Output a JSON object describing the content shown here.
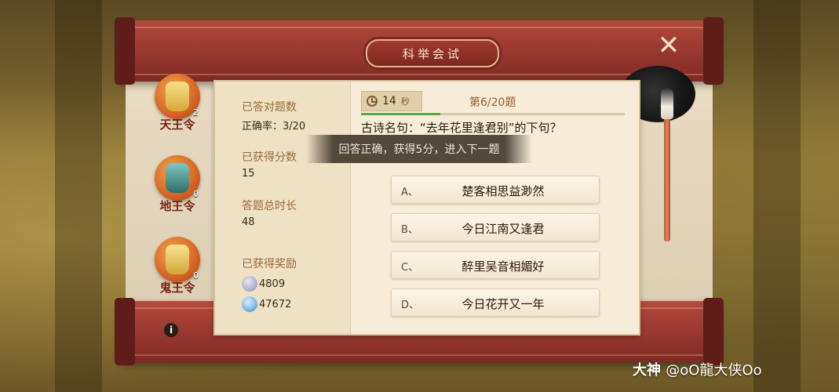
{
  "window": {
    "title": "科举会试"
  },
  "colors": {
    "accent_red": "#9c3a30",
    "progress_green": "#5aa84a",
    "paper": "#f6ecd8"
  },
  "tokens": [
    {
      "name": "天王令",
      "count": "2",
      "icon": "tianwang-token-icon",
      "color": "#e6c04a"
    },
    {
      "name": "地王令",
      "count": "0",
      "icon": "diwang-token-icon",
      "color": "#3f8a86"
    },
    {
      "name": "鬼王令",
      "count": "0",
      "icon": "guiwang-token-icon",
      "color": "#e7c44a"
    }
  ],
  "stats": {
    "correct_label": "已答对题数",
    "correct_value": "正确率：3/20",
    "score_label": "已获得分数",
    "score_value": "15",
    "time_label": "答题总时长",
    "time_value": "48",
    "reward_label": "已获得奖励",
    "rewards": [
      {
        "icon": "silver-coin-icon",
        "value": "4809"
      },
      {
        "icon": "experience-icon",
        "value": "47672"
      }
    ]
  },
  "timer": {
    "value": "14",
    "unit": "秒"
  },
  "progress": {
    "label": "第6/20题",
    "fraction": 0.3
  },
  "question": "古诗名句：“去年花里逢君别”的下句？",
  "toast": "回答正确，获得5分，进入下一题",
  "options": [
    {
      "letter": "A、",
      "text": "楚客相思益渺然"
    },
    {
      "letter": "B、",
      "text": "今日江南又逢君"
    },
    {
      "letter": "C、",
      "text": "醉里吴音相媚好"
    },
    {
      "letter": "D、",
      "text": "今日花开又一年"
    }
  ],
  "buttons": {
    "close": "✕",
    "info": "i"
  },
  "watermark": {
    "brand": "大神",
    "user": "@oO龍大侠Oo"
  }
}
